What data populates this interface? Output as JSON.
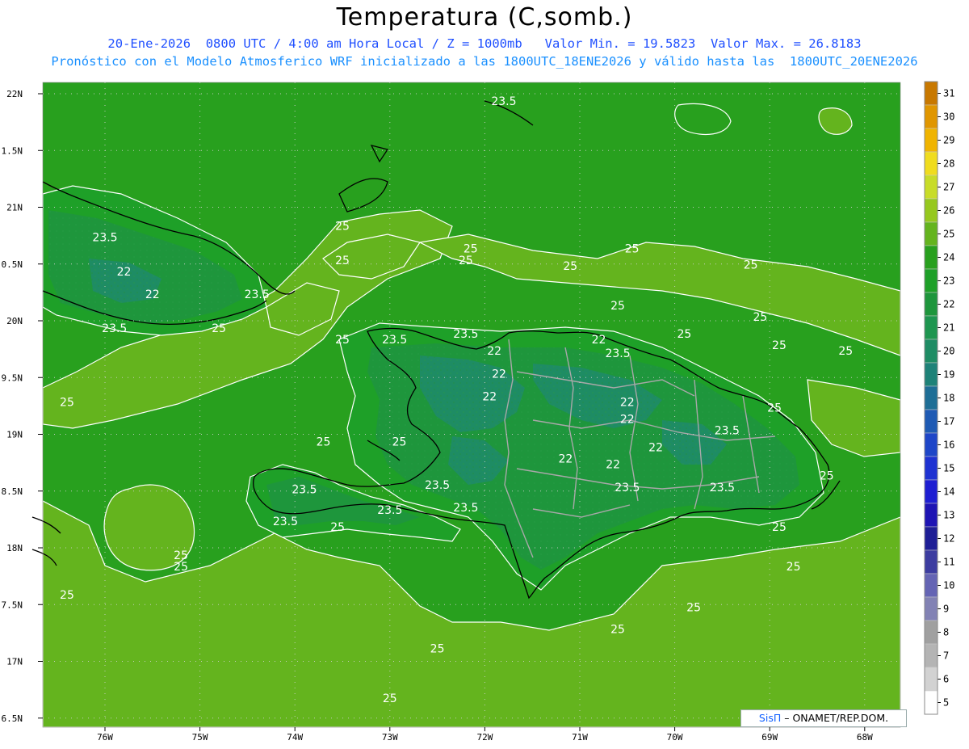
{
  "header": {
    "title": "Temperatura (C,somb.)",
    "subtitle_line1": "20-Ene-2026  0800 UTC / 4:00 am Hora Local / Z = 1000mb   Valor Min. = 19.5823  Valor Max. = 26.8183",
    "subtitle_line2": "Pronóstico con el Modelo Atmosferico WRF inicializado a las 1800UTC_18ENE2026 y válido hasta las  1800UTC_20ENE2026"
  },
  "axes": {
    "longitude_labels": [
      "76W",
      "75W",
      "74W",
      "73W",
      "72W",
      "71W",
      "70W",
      "69W",
      "68W"
    ],
    "latitude_labels": [
      "22N",
      "1.5N",
      "21N",
      "0.5N",
      "20N",
      "9.5N",
      "19N",
      "8.5N",
      "18N",
      "7.5N",
      "17N",
      "6.5N"
    ]
  },
  "colorbar": {
    "levels": [
      "31",
      "30",
      "29",
      "28",
      "27",
      "26",
      "25",
      "24",
      "23",
      "22",
      "21",
      "20",
      "19",
      "18",
      "17",
      "16",
      "15",
      "14",
      "13",
      "12",
      "11",
      "10",
      "9",
      "8",
      "7",
      "6",
      "5"
    ],
    "colors": [
      "#c87800",
      "#e09600",
      "#f0b400",
      "#f0dc1e",
      "#c8dc28",
      "#96c81e",
      "#64b41e",
      "#28a01e",
      "#1ea028",
      "#1e963c",
      "#1e9650",
      "#1e8c64",
      "#1e8278",
      "#1e6e96",
      "#1e5ab4",
      "#1e46c8",
      "#1e32d2",
      "#1e1ed2",
      "#1e14b4",
      "#1e1e96",
      "#3c3ca0",
      "#6464b4",
      "#8282b4",
      "#a0a0a0",
      "#b4b4b4",
      "#d2d2d2",
      "#ffffff"
    ]
  },
  "contour_labels": [
    {
      "text": "25",
      "lon": -73.5,
      "lat": 20.8
    },
    {
      "text": "25",
      "lon": -73.5,
      "lat": 20.5
    },
    {
      "text": "23.5",
      "lon": -76.0,
      "lat": 20.7
    },
    {
      "text": "22",
      "lon": -75.8,
      "lat": 20.4
    },
    {
      "text": "22",
      "lon": -75.5,
      "lat": 20.2
    },
    {
      "text": "23.5",
      "lon": -74.4,
      "lat": 20.2
    },
    {
      "text": "23.5",
      "lon": -75.9,
      "lat": 19.9
    },
    {
      "text": "25",
      "lon": -74.8,
      "lat": 19.9
    },
    {
      "text": "25",
      "lon": -76.4,
      "lat": 19.25
    },
    {
      "text": "23.5",
      "lon": -71.8,
      "lat": 21.9
    },
    {
      "text": "25",
      "lon": -72.15,
      "lat": 20.6
    },
    {
      "text": "25",
      "lon": -72.2,
      "lat": 20.5
    },
    {
      "text": "25",
      "lon": -70.45,
      "lat": 20.6
    },
    {
      "text": "25",
      "lon": -71.1,
      "lat": 20.45
    },
    {
      "text": "25",
      "lon": -69.2,
      "lat": 20.46
    },
    {
      "text": "25",
      "lon": -70.6,
      "lat": 20.1
    },
    {
      "text": "25",
      "lon": -69.9,
      "lat": 19.85
    },
    {
      "text": "25",
      "lon": -69.1,
      "lat": 20.0
    },
    {
      "text": "25",
      "lon": -68.9,
      "lat": 19.75
    },
    {
      "text": "25",
      "lon": -68.2,
      "lat": 19.7
    },
    {
      "text": "25",
      "lon": -73.5,
      "lat": 19.8
    },
    {
      "text": "23.5",
      "lon": -72.95,
      "lat": 19.8
    },
    {
      "text": "23.5",
      "lon": -72.2,
      "lat": 19.85
    },
    {
      "text": "22",
      "lon": -71.9,
      "lat": 19.7
    },
    {
      "text": "22",
      "lon": -71.85,
      "lat": 19.5
    },
    {
      "text": "22",
      "lon": -71.95,
      "lat": 19.3
    },
    {
      "text": "22",
      "lon": -70.8,
      "lat": 19.8
    },
    {
      "text": "23.5",
      "lon": -70.6,
      "lat": 19.68
    },
    {
      "text": "22",
      "lon": -70.5,
      "lat": 19.25
    },
    {
      "text": "22",
      "lon": -70.5,
      "lat": 19.1
    },
    {
      "text": "22",
      "lon": -70.2,
      "lat": 18.85
    },
    {
      "text": "23.5",
      "lon": -69.45,
      "lat": 19.0
    },
    {
      "text": "25",
      "lon": -68.95,
      "lat": 19.2
    },
    {
      "text": "22",
      "lon": -70.65,
      "lat": 18.7
    },
    {
      "text": "22",
      "lon": -71.15,
      "lat": 18.75
    },
    {
      "text": "23.5",
      "lon": -70.5,
      "lat": 18.5
    },
    {
      "text": "23.5",
      "lon": -69.5,
      "lat": 18.5
    },
    {
      "text": "25",
      "lon": -68.4,
      "lat": 18.6
    },
    {
      "text": "25",
      "lon": -68.9,
      "lat": 18.15
    },
    {
      "text": "25",
      "lon": -68.75,
      "lat": 17.8
    },
    {
      "text": "25",
      "lon": -73.7,
      "lat": 18.9
    },
    {
      "text": "25",
      "lon": -72.9,
      "lat": 18.9
    },
    {
      "text": "23.5",
      "lon": -73.9,
      "lat": 18.48
    },
    {
      "text": "23.5",
      "lon": -74.1,
      "lat": 18.2
    },
    {
      "text": "25",
      "lon": -73.55,
      "lat": 18.15
    },
    {
      "text": "23.5",
      "lon": -73.0,
      "lat": 18.3
    },
    {
      "text": "23.5",
      "lon": -72.5,
      "lat": 18.52
    },
    {
      "text": "23.5",
      "lon": -72.2,
      "lat": 18.32
    },
    {
      "text": "25",
      "lon": -75.2,
      "lat": 17.9
    },
    {
      "text": "25",
      "lon": -75.2,
      "lat": 17.8
    },
    {
      "text": "25",
      "lon": -76.4,
      "lat": 17.55
    },
    {
      "text": "25",
      "lon": -69.8,
      "lat": 17.44
    },
    {
      "text": "25",
      "lon": -70.6,
      "lat": 17.25
    },
    {
      "text": "25",
      "lon": -72.5,
      "lat": 17.08
    },
    {
      "text": "25",
      "lon": -73.0,
      "lat": 16.64
    }
  ],
  "credit": {
    "sis": "SisΠ",
    "rest": "– ONAMET/REP.DOM."
  }
}
